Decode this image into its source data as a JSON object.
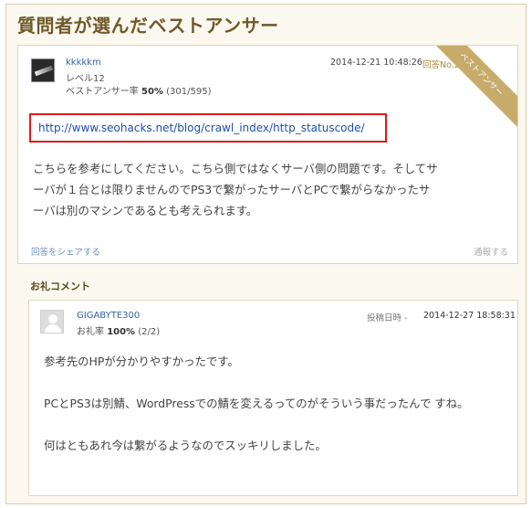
{
  "section": {
    "title": "質問者が選んだベストアンサー"
  },
  "answer": {
    "user_name": "kkkkkm",
    "level_label": "レベル12",
    "best_rate_label": "ベストアンサー率",
    "best_rate_value": "50%",
    "best_rate_count": "(301/595)",
    "date": "2014-12-21 10:48:26",
    "answer_no": "回答No.2",
    "badge_label": "ベストアンサー",
    "link": "http://www.seohacks.net/blog/crawl_index/http_statuscode/",
    "body_lines": [
      "こちらを参考にしてください。こちら側ではなくサーバ側の問題です。そしてサ",
      "ーバが１台とは限りませんのでPS3で繋がったサーバとPCで繋がらなかったサ",
      "ーバは別のマシンであるとも考えられます。"
    ],
    "share_label": "回答をシェアする",
    "report_label": "通報する"
  },
  "thanks": {
    "title": "お礼コメント",
    "user_name": "GIGABYTE300",
    "rate_label": "お礼率",
    "rate_value": "100%",
    "rate_count": "(2/2)",
    "posted_label": "投稿日時 -",
    "posted_date": "2014-12-27 18:58:31",
    "paragraphs": [
      "参考先のHPが分かりやすかったです。",
      "PCとPS3は別鯖、WordPressでの鯖を変えるってのがそういう事だったんで すね。",
      "何はともあれ今は繋がるようなのでスッキリしました。"
    ]
  },
  "colors": {
    "accent": "#c7ab6a",
    "link": "#1f4fb3",
    "highlight_border": "#e01818"
  },
  "icons": {
    "badge": "crown-hand-icon",
    "user_avatar": "avatar-image",
    "thanks_avatar": "default-avatar-icon"
  }
}
